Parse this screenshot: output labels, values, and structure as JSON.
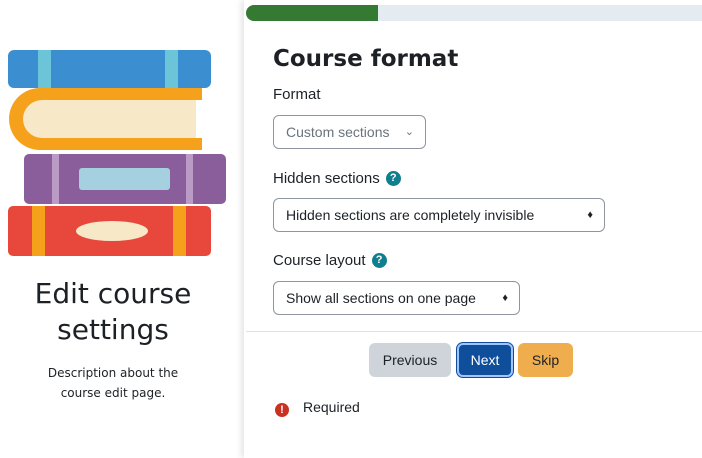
{
  "sidebar": {
    "title_line1": "Edit course",
    "title_line2": "settings",
    "description": "Description about the course edit page."
  },
  "progress": {
    "fraction": 0.29,
    "color": "#357a32"
  },
  "form": {
    "heading": "Course format",
    "format_label": "Format",
    "format_value": "Custom sections",
    "hidden_sections_label": "Hidden sections",
    "hidden_sections_value": "Hidden sections are completely invisible",
    "course_layout_label": "Course layout",
    "course_layout_value": "Show all sections on one page",
    "help_icon_glyph": "?"
  },
  "buttons": {
    "previous": "Previous",
    "next": "Next",
    "skip": "Skip"
  },
  "required": {
    "label": "Required",
    "icon_glyph": "!"
  },
  "colors": {
    "next_button": "#0f4e9a",
    "skip_button": "#f0ad4e",
    "required_icon": "#ca3120",
    "help_icon": "#0f7e8f"
  }
}
